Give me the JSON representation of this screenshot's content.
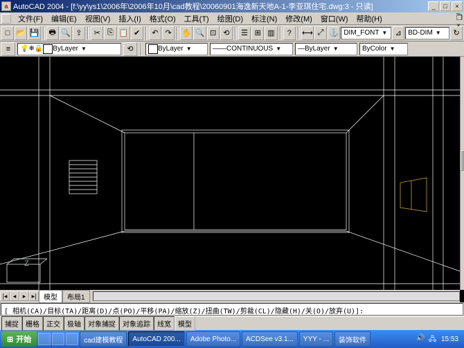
{
  "titlebar": {
    "app_icon_char": "a",
    "title": "AutoCAD 2004 - [f:\\yy\\ys1\\2006年\\2006年10月\\cad教程\\20060901海逸新天地A-1-李亚琪住宅.dwg:3 - 只读]"
  },
  "menubar": {
    "items": [
      "文件(F)",
      "编辑(E)",
      "视图(V)",
      "插入(I)",
      "格式(O)",
      "工具(T)",
      "绘图(D)",
      "标注(N)",
      "修改(M)",
      "窗口(W)",
      "帮助(H)"
    ]
  },
  "toolbar1": {
    "dim_style": "DIM_FONT",
    "dim_style2": "BD-DIM"
  },
  "properties": {
    "layer": "ByLayer",
    "linetype": "CONTINUOUS",
    "lineweight": "ByLayer",
    "color": "ByColor"
  },
  "viewport": {
    "ucs_label": "Z"
  },
  "tabs": {
    "items": [
      "模型",
      "布局1"
    ],
    "active_index": 0
  },
  "command_line": "[ 相机(CA)/目标(TA)/距离(D)/点(PO)/平移(PA)/缩放(Z)/扭曲(TW)/剪裁(CL)/隐藏(H)/关(O)/放弃(U)]:",
  "statusbar": {
    "buttons": [
      "捕捉",
      "栅格",
      "正交",
      "极轴",
      "对象捕捉",
      "对象追踪",
      "线宽",
      "模型"
    ]
  },
  "taskbar": {
    "start": "开始",
    "tasks": [
      "cad建模教程",
      "AutoCAD 200...",
      "Adobe Photo...",
      "ACDSee v3.1...",
      "YYY - ...",
      "装饰软件"
    ],
    "active_task_index": 1,
    "clock": "15:53"
  },
  "icons": {
    "new": "□",
    "open": "📂",
    "save": "💾",
    "print": "🖶",
    "preview": "🔍",
    "cut": "✂",
    "copy": "⎘",
    "paste": "📋",
    "match": "✔",
    "undo": "↶",
    "redo": "↷",
    "pan": "✋",
    "zoom": "🔍",
    "zoomwin": "⊡",
    "zoomprev": "⟲",
    "props": "☰",
    "help": "?",
    "anchor": "⚓",
    "dim1": "⟷"
  },
  "colors": {
    "layer_swatch": "#ffffff",
    "wireframe": "#ffffff",
    "highlight": "#caa038"
  }
}
